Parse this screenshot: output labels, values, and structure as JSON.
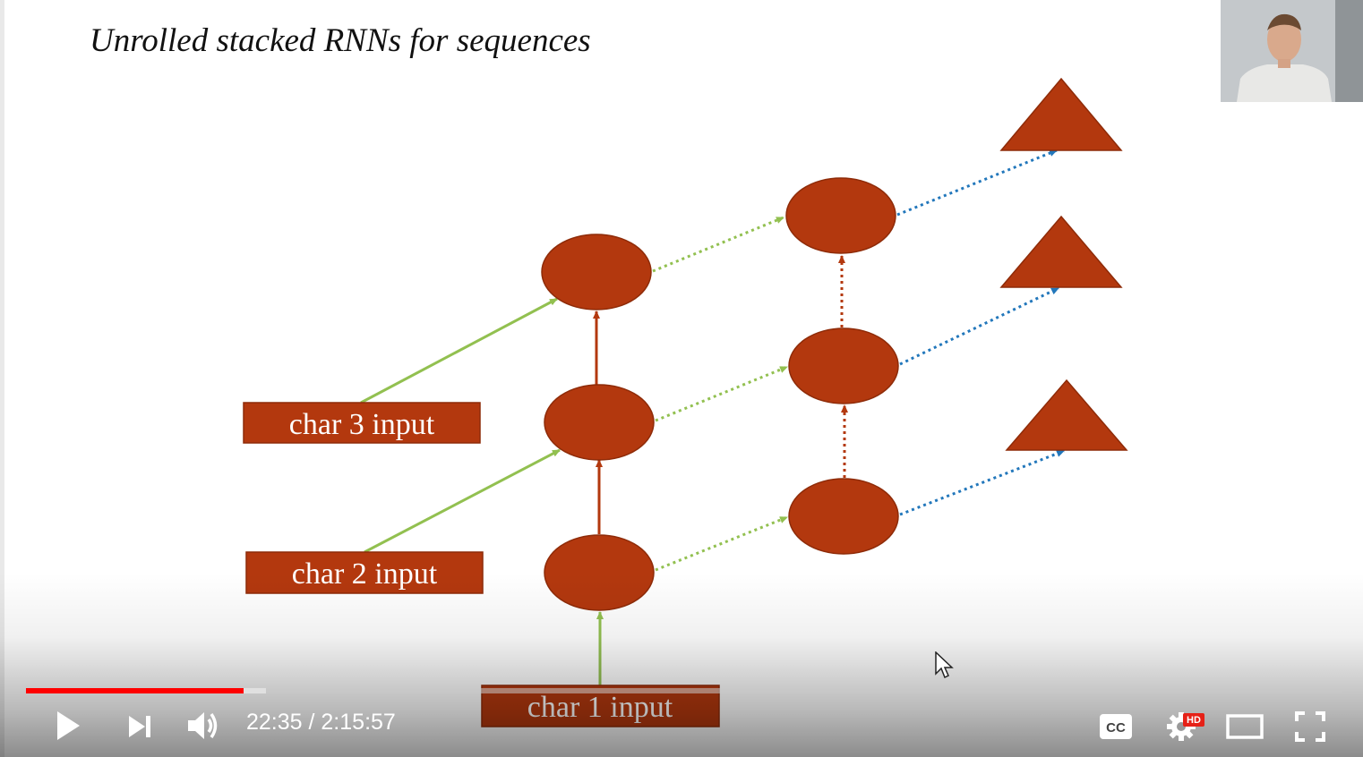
{
  "slide": {
    "title": "Unrolled stacked RNNs for sequences",
    "inputs": [
      "char 3 input",
      "char 2 input",
      "char 1 input"
    ]
  },
  "player": {
    "time_current": "22:35",
    "time_separator": " / ",
    "time_total": "2:15:57",
    "progress_played_fraction": 0.1653,
    "progress_buffered_fraction": 0.1823,
    "hd_badge": "HD",
    "controls": {
      "play": "play-icon",
      "next": "next-icon",
      "volume": "volume-icon",
      "captions": "captions-icon",
      "settings": "gear-icon",
      "theater": "theater-mode-icon",
      "fullscreen": "fullscreen-icon"
    }
  },
  "colors": {
    "node_fill": "#b3380e",
    "green_arrow": "#92c050",
    "red_arrow": "#b3380e",
    "blue_arrow": "#2277bb",
    "progress_red": "#ff0000"
  }
}
